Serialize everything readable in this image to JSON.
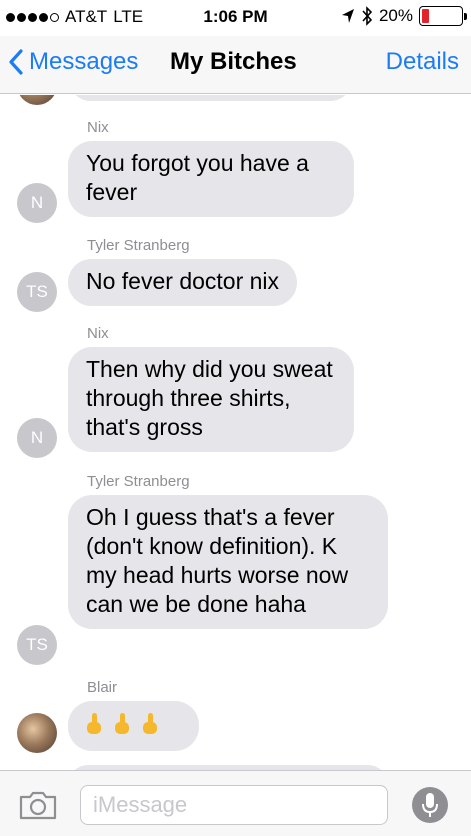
{
  "status_bar": {
    "carrier": "AT&T",
    "network": "LTE",
    "time": "1:06 PM",
    "battery_percent_text": "20%",
    "battery_level": 0.2,
    "battery_color": "#e2252a",
    "signal_dots_filled": 4,
    "signal_dots_total": 5
  },
  "nav": {
    "back_label": "Messages",
    "title": "My Bitches",
    "details_label": "Details",
    "accent_color": "#1c7cf4"
  },
  "messages": [
    {
      "sender": "Nix",
      "avatar_initials": "N",
      "text": "You forgot you have a fever"
    },
    {
      "sender": "Tyler Stranberg",
      "avatar_initials": "TS",
      "text": "No fever doctor nix"
    },
    {
      "sender": "Nix",
      "avatar_initials": "N",
      "text": "Then why did you sweat through three shirts, that's gross"
    },
    {
      "sender": "Tyler Stranberg",
      "avatar_initials": "TS",
      "text": "Oh I guess that's a fever (don't know definition). K my head hurts worse now can we be done haha"
    },
    {
      "sender": "Blair",
      "avatar_initials": "",
      "avatar_type": "photo",
      "content_type": "emoji",
      "emoji_icons": [
        "pointing-up-hand-icon",
        "pointing-up-hand-icon",
        "pointing-up-hand-icon"
      ]
    }
  ],
  "input": {
    "placeholder": "iMessage",
    "camera_icon": "camera-icon",
    "mic_icon": "microphone-icon"
  }
}
